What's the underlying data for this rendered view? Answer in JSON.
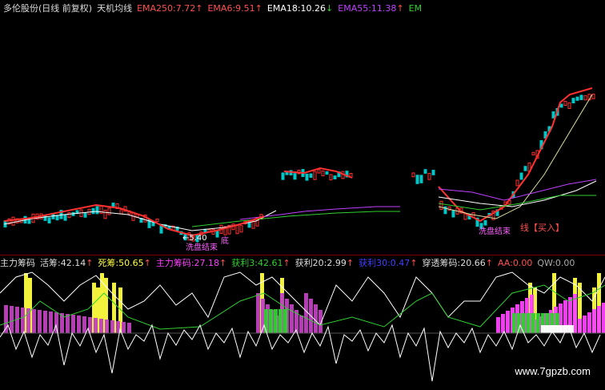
{
  "header": {
    "title": "多伦股份(日线 前复权)",
    "indicator": "天机均线",
    "ema250": "EMA250:7.72",
    "ema6": "EMA6:9.51",
    "ema18": "EMA18:10.26",
    "ema55": "EMA55:11.38",
    "ema_extra": "EM",
    "arrow_up": "↑",
    "arrow_down": "↓"
  },
  "chart_labels": {
    "low_price": "←5.40",
    "wash_end_1": "洗盘结束",
    "wash_end_2": "洗盘结束",
    "bottom_tag": "底",
    "buy_tag": "线【买入】"
  },
  "indicator_bar": {
    "name": "主力筹码",
    "active": "活筹:42.14",
    "dead": "死筹:50.65",
    "main_chip": "主力筹码:27.18",
    "profit3": "获利3:42.61",
    "profit20": "获利20:2.99",
    "profit30": "获利30:0.47",
    "penetrate": "穿透筹码:20.66",
    "aa": "AA:0.00",
    "qw": "QW:0.00"
  },
  "watermark": "www.7gpzb.com",
  "colors": {
    "bg": "#000000",
    "up": "#ff3030",
    "down": "#00c8c8",
    "ema250": "#ff5050",
    "ema6": "#ff5050",
    "ema18": "#ffffff",
    "ema55": "#c040ff",
    "green": "#30d030",
    "yellow": "#ffff40",
    "magenta": "#ff40ff",
    "purple": "#c040c0"
  }
}
